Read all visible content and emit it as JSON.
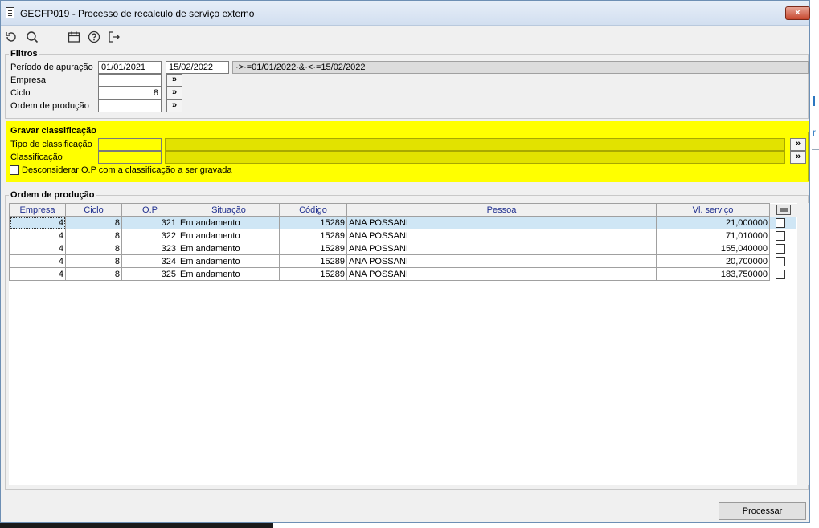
{
  "window": {
    "title": "GECFP019 - Processo de recalculo de serviço externo",
    "close_label": "×"
  },
  "toolbar": {
    "icons": [
      "refresh-icon",
      "search-icon",
      "calendar-icon",
      "help-icon",
      "exit-icon"
    ]
  },
  "filtros": {
    "legend": "Filtros",
    "periodo_label": "Período de apuração",
    "periodo_inicio": "01/01/2021",
    "periodo_fim": "15/02/2022",
    "periodo_expr": "·>·=01/01/2022·&·<·=15/02/2022",
    "empresa_label": "Empresa",
    "empresa_value": "",
    "ciclo_label": "Ciclo",
    "ciclo_value": "8",
    "ordem_label": "Ordem de produção",
    "ordem_value": "",
    "lookup_label": "»"
  },
  "gravar": {
    "legend": "Gravar classificação",
    "tipo_label": "Tipo de classificação",
    "tipo_value": "",
    "classificacao_label": "Classificação",
    "classificacao_value": "",
    "desconsiderar_label": "Desconsiderar O.P com a classificação a ser gravada",
    "lookup_label": "»",
    "highlight_color": "#ffff00"
  },
  "ordem": {
    "legend": "Ordem de produção",
    "columns": [
      "Empresa",
      "Ciclo",
      "O.P",
      "Situação",
      "Código",
      "Pessoa",
      "Vl. serviço"
    ],
    "rows": [
      {
        "empresa": "4",
        "ciclo": "8",
        "op": "321",
        "situacao": "Em andamento",
        "codigo": "15289",
        "pessoa": "ANA POSSANI",
        "valor": "21,000000"
      },
      {
        "empresa": "4",
        "ciclo": "8",
        "op": "322",
        "situacao": "Em andamento",
        "codigo": "15289",
        "pessoa": "ANA POSSANI",
        "valor": "71,010000"
      },
      {
        "empresa": "4",
        "ciclo": "8",
        "op": "323",
        "situacao": "Em andamento",
        "codigo": "15289",
        "pessoa": "ANA POSSANI",
        "valor": "155,040000"
      },
      {
        "empresa": "4",
        "ciclo": "8",
        "op": "324",
        "situacao": "Em andamento",
        "codigo": "15289",
        "pessoa": "ANA POSSANI",
        "valor": "20,700000"
      },
      {
        "empresa": "4",
        "ciclo": "8",
        "op": "325",
        "situacao": "Em andamento",
        "codigo": "15289",
        "pessoa": "ANA POSSANI",
        "valor": "183,750000"
      }
    ]
  },
  "actions": {
    "processar_label": "Processar"
  }
}
